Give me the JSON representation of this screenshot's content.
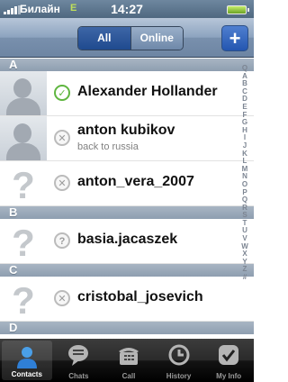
{
  "status_bar": {
    "carrier": "Билайн",
    "network": "E",
    "time": "14:27"
  },
  "nav": {
    "segments": [
      "All",
      "Online"
    ],
    "selected_segment": "All",
    "add_label": "+"
  },
  "sections": [
    {
      "letter": "A",
      "rows": [
        {
          "name": "Alexander Hollander",
          "subtitle": "",
          "avatar": "person-icon",
          "status": "online"
        },
        {
          "name": "anton kubikov",
          "subtitle": "back to russia",
          "avatar": "person-icon",
          "status": "offline"
        },
        {
          "name": "anton_vera_2007",
          "subtitle": "",
          "avatar": "unknown-icon",
          "status": "offline"
        }
      ]
    },
    {
      "letter": "B",
      "rows": [
        {
          "name": "basia.jacaszek",
          "subtitle": "",
          "avatar": "unknown-icon",
          "status": "away"
        }
      ]
    },
    {
      "letter": "C",
      "rows": [
        {
          "name": "cristobal_josevich",
          "subtitle": "",
          "avatar": "unknown-icon",
          "status": "offline"
        }
      ]
    },
    {
      "letter": "D",
      "rows": []
    }
  ],
  "index_letters": [
    "Q",
    "A",
    "B",
    "C",
    "D",
    "E",
    "F",
    "G",
    "H",
    "I",
    "J",
    "K",
    "L",
    "M",
    "N",
    "O",
    "P",
    "Q",
    "R",
    "S",
    "T",
    "U",
    "V",
    "W",
    "X",
    "Y",
    "Z",
    "#"
  ],
  "status_symbols": {
    "online": "✓",
    "offline": "✕",
    "away": "?"
  },
  "tabs": [
    {
      "label": "Contacts",
      "icon": "contacts-icon",
      "active": true
    },
    {
      "label": "Chats",
      "icon": "chats-icon",
      "active": false
    },
    {
      "label": "Call",
      "icon": "call-icon",
      "active": false
    },
    {
      "label": "History",
      "icon": "history-icon",
      "active": false
    },
    {
      "label": "My Info",
      "icon": "my-info-icon",
      "active": false
    }
  ],
  "colors": {
    "nav_bar": "#8ca3bf",
    "selected_segment": "#2a559a",
    "online": "#5fb640",
    "tab_bar": "#1a1a1a"
  }
}
